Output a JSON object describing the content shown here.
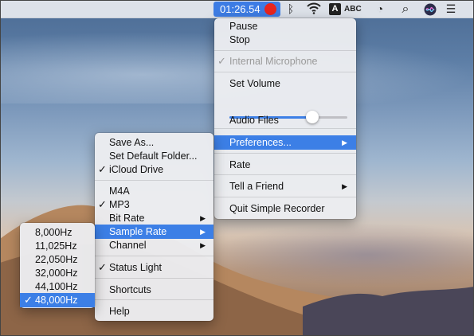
{
  "menubar": {
    "timer": "01:26.54",
    "record_color": "#e8251e",
    "icons": [
      "bluetooth-icon",
      "wifi-icon",
      "input-source-icon",
      "clock-icon",
      "spotlight-search-icon",
      "siri-icon",
      "notification-list-icon"
    ],
    "input_letter": "A",
    "input_source": "ABC"
  },
  "main_menu": {
    "items": {
      "pause": "Pause",
      "stop": "Stop",
      "internal_mic": "Internal Microphone",
      "set_volume": "Set Volume",
      "audio_files": "Audio Files",
      "preferences": "Preferences...",
      "rate": "Rate",
      "tell_friend": "Tell a Friend",
      "quit": "Quit Simple Recorder"
    },
    "volume_level": 0.7
  },
  "prefs_menu": {
    "items": {
      "save_as": "Save As...",
      "set_default_folder": "Set Default Folder...",
      "icloud": "iCloud Drive",
      "m4a": "M4A",
      "mp3": "MP3",
      "bit_rate": "Bit Rate",
      "sample_rate": "Sample Rate",
      "channel": "Channel",
      "status_light": "Status Light",
      "shortcuts": "Shortcuts",
      "help": "Help"
    }
  },
  "sample_rate_menu": {
    "items": [
      "8,000Hz",
      "11,025Hz",
      "22,050Hz",
      "32,000Hz",
      "44,100Hz",
      "48,000Hz"
    ],
    "selected": "48,000Hz"
  },
  "glyphs": {
    "check": "✓",
    "arrow": "▶",
    "bluetooth": "ᛒ",
    "clock": "◔",
    "search": "⌕",
    "list": "☰"
  },
  "colors": {
    "accent": "#3c7fe6",
    "timer_bg": "#3d7ce4"
  }
}
